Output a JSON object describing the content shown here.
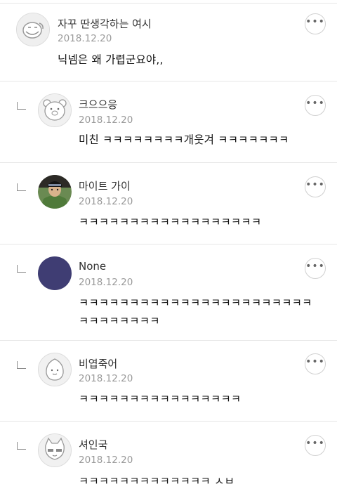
{
  "more_icon_glyph": "•••",
  "comments": [
    {
      "username": "자꾸 딴생각하는 여시",
      "date": "2018.12.20",
      "lines": [
        "닉넴은 왜 가렵군요야,,"
      ]
    },
    {
      "username": "크으으응",
      "date": "2018.12.20",
      "lines": [
        "미친 ㅋㅋㅋㅋㅋㅋㅋㅋ개웃겨 ㅋㅋㅋㅋㅋㅋㅋ"
      ]
    },
    {
      "username": "마이트 가이",
      "date": "2018.12.20",
      "lines": [
        "ㅋㅋㅋㅋㅋㅋㅋㅋㅋㅋㅋㅋㅋㅋㅋㅋㅋㅋ"
      ]
    },
    {
      "username": "None",
      "date": "2018.12.20",
      "lines": [
        "ㅋㅋㅋㅋㅋㅋㅋㅋㅋㅋㅋㅋㅋㅋㅋㅋㅋㅋㅋㅋㅋㅋㅋ",
        "ㅋㅋㅋㅋㅋㅋㅋㅋ"
      ]
    },
    {
      "username": "비엽죽어",
      "date": "2018.12.20",
      "lines": [
        "ㅋㅋㅋㅋㅋㅋㅋㅋㅋㅋㅋㅋㅋㅋㅋㅋ"
      ]
    },
    {
      "username": "셔인국",
      "date": "2018.12.20",
      "lines": [
        "ㅋㅋㅋㅋㅋㅋㅋㅋㅋㅋㅋㅋㅋ ㅅㅂ"
      ]
    }
  ]
}
